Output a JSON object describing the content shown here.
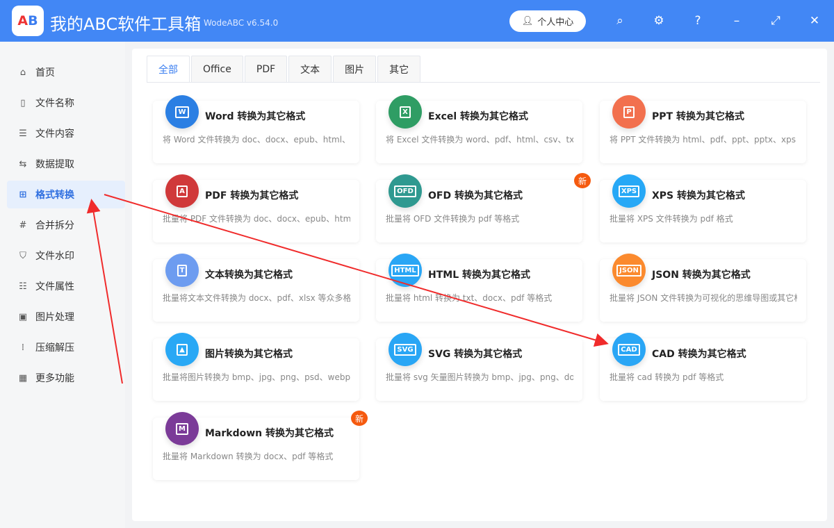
{
  "app": {
    "title": "我的ABC软件工具箱",
    "version": "WodeABC v6.54.0",
    "logo_text": "AB",
    "user_center": "个人中心"
  },
  "sidebar": {
    "items": [
      {
        "label": "首页",
        "icon": "home-icon",
        "glyph": "⌂"
      },
      {
        "label": "文件名称",
        "icon": "file-name-icon",
        "glyph": "▯"
      },
      {
        "label": "文件内容",
        "icon": "file-content-icon",
        "glyph": "☰"
      },
      {
        "label": "数据提取",
        "icon": "data-extract-icon",
        "glyph": "⇆"
      },
      {
        "label": "格式转换",
        "icon": "format-convert-icon",
        "glyph": "⊞",
        "active": true
      },
      {
        "label": "合并拆分",
        "icon": "merge-split-icon",
        "glyph": "#"
      },
      {
        "label": "文件水印",
        "icon": "watermark-icon",
        "glyph": "⛉"
      },
      {
        "label": "文件属性",
        "icon": "file-properties-icon",
        "glyph": "☷"
      },
      {
        "label": "图片处理",
        "icon": "image-icon",
        "glyph": "▣"
      },
      {
        "label": "压缩解压",
        "icon": "compress-icon",
        "glyph": "⁞"
      },
      {
        "label": "更多功能",
        "icon": "more-icon",
        "glyph": "▦"
      }
    ]
  },
  "tabs": [
    "全部",
    "Office",
    "PDF",
    "文本",
    "图片",
    "其它"
  ],
  "badge_label": "新",
  "cards": [
    {
      "title": "Word 转换为其它格式",
      "desc": "将 Word 文件转换为 doc、docx、epub、html、pdf",
      "icon": "W",
      "color": "#2b7fe3",
      "name": "word"
    },
    {
      "title": "Excel 转换为其它格式",
      "desc": "将 Excel 文件转换为 word、pdf、html、csv、txt、s",
      "icon": "X",
      "color": "#2f9d64",
      "name": "excel"
    },
    {
      "title": "PPT 转换为其它格式",
      "desc": "将 PPT 文件转换为 html、pdf、ppt、pptx、xps 等",
      "icon": "P",
      "color": "#f2704e",
      "name": "ppt"
    },
    {
      "title": "PDF 转换为其它格式",
      "desc": "批量将 PDF 文件转换为 doc、docx、epub、html、",
      "icon": "A",
      "color": "#d0393a",
      "name": "pdf"
    },
    {
      "title": "OFD 转换为其它格式",
      "desc": "批量将 OFD 文件转换为 pdf 等格式",
      "icon": "OFD",
      "color": "#2f9990",
      "name": "ofd",
      "new": true
    },
    {
      "title": "XPS 转换为其它格式",
      "desc": "批量将 XPS 文件转换为 pdf 格式",
      "icon": "XPS",
      "color": "#27a8f6",
      "name": "xps"
    },
    {
      "title": "文本转换为其它格式",
      "desc": "批量将文本文件转换为 docx、pdf、xlsx 等众多格式",
      "icon": "T",
      "color": "#6d9cf0",
      "name": "text"
    },
    {
      "title": "HTML 转换为其它格式",
      "desc": "批量将 html 转换为 txt、docx、pdf 等格式",
      "icon": "HTML",
      "color": "#29a6f5",
      "name": "html"
    },
    {
      "title": "JSON 转换为其它格式",
      "desc": "批量将 JSON 文件转换为可视化的思维导图或其它格",
      "icon": "JSON",
      "color": "#fb8a2e",
      "name": "json"
    },
    {
      "title": "图片转换为其它格式",
      "desc": "批量将图片转换为 bmp、jpg、png、psd、webp、",
      "icon": "▲",
      "color": "#29a8f5",
      "name": "image"
    },
    {
      "title": "SVG 转换为其它格式",
      "desc": "批量将 svg 矢量图片转换为 bmp、jpg、png、docx",
      "icon": "SVG",
      "color": "#29a6f5",
      "name": "svg"
    },
    {
      "title": "CAD 转换为其它格式",
      "desc": "批量将 cad 转换为 pdf 等格式",
      "icon": "CAD",
      "color": "#2aa6f5",
      "name": "cad"
    },
    {
      "title": "Markdown 转换为其它格式",
      "desc": "批量将 Markdown 转换为 docx、pdf 等格式",
      "icon": "M",
      "color": "#7b3b98",
      "name": "markdown",
      "new": true
    }
  ]
}
